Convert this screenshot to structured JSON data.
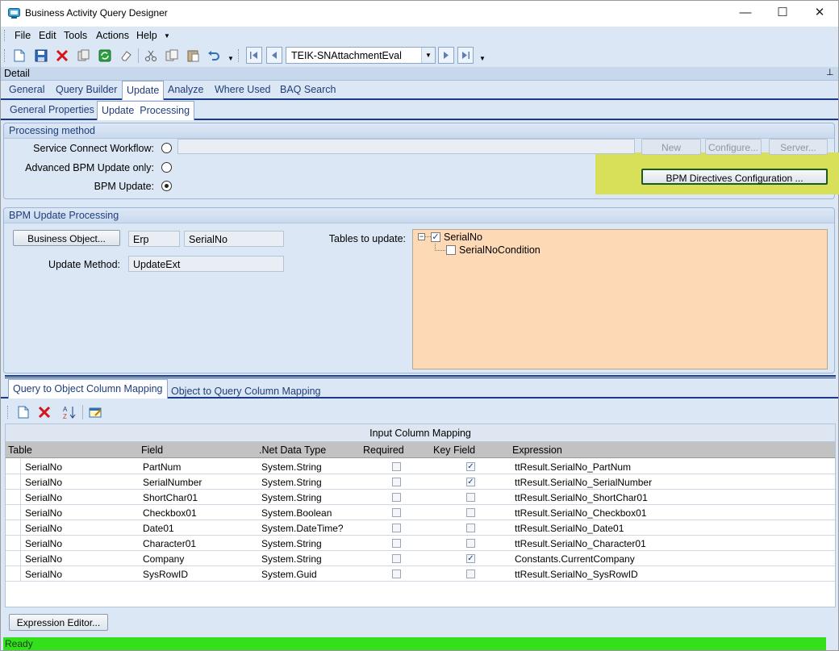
{
  "window": {
    "title": "Business Activity Query Designer",
    "minimize": "—",
    "maximize": "☐",
    "close": "✕"
  },
  "menu": [
    "File",
    "Edit",
    "Tools",
    "Actions",
    "Help"
  ],
  "toolbar": {
    "query_name": "TEIK-SNAttachmentEval"
  },
  "detail_label": "Detail",
  "main_tabs": [
    "General",
    "Query Builder",
    "Update",
    "Analyze",
    "Where Used",
    "BAQ Search"
  ],
  "sub_tabs": [
    "General Properties",
    "Update  Processing"
  ],
  "processing_method": {
    "header": "Processing method",
    "service_connect_label": "Service Connect Workflow:",
    "advanced_bpm_label": "Advanced BPM Update only:",
    "bpm_update_label": "BPM Update:",
    "new_button": "New",
    "configure_button": "Configure...",
    "server_button": "Server...",
    "bpm_directives_button": "BPM Directives Configuration ..."
  },
  "bpm_update_processing": {
    "header": "BPM Update Processing",
    "business_object_button": "Business Object...",
    "business_object_module": "Erp",
    "business_object_name": "SerialNo",
    "update_method_label": "Update Method:",
    "update_method_value": "UpdateExt",
    "tables_label": "Tables to update:",
    "tables": [
      {
        "name": "SerialNo",
        "checked": true
      },
      {
        "name": "SerialNoCondition",
        "checked": false
      }
    ]
  },
  "mapping_tabs": [
    "Query to Object Column Mapping",
    "Object to Query Column Mapping"
  ],
  "grid": {
    "title": "Input Column Mapping",
    "columns": [
      "Table",
      "Field",
      ".Net Data Type",
      "Required",
      "Key Field",
      "Expression"
    ],
    "rows": [
      {
        "table": "SerialNo",
        "field": "PartNum",
        "type": "System.String",
        "required": false,
        "key": true,
        "expression": "ttResult.SerialNo_PartNum"
      },
      {
        "table": "SerialNo",
        "field": "SerialNumber",
        "type": "System.String",
        "required": false,
        "key": true,
        "expression": "ttResult.SerialNo_SerialNumber"
      },
      {
        "table": "SerialNo",
        "field": "ShortChar01",
        "type": "System.String",
        "required": false,
        "key": false,
        "expression": "ttResult.SerialNo_ShortChar01"
      },
      {
        "table": "SerialNo",
        "field": "Checkbox01",
        "type": "System.Boolean",
        "required": false,
        "key": false,
        "expression": "ttResult.SerialNo_Checkbox01"
      },
      {
        "table": "SerialNo",
        "field": "Date01",
        "type": "System.DateTime?",
        "required": false,
        "key": false,
        "expression": "ttResult.SerialNo_Date01"
      },
      {
        "table": "SerialNo",
        "field": "Character01",
        "type": "System.String",
        "required": false,
        "key": false,
        "expression": "ttResult.SerialNo_Character01"
      },
      {
        "table": "SerialNo",
        "field": "Company",
        "type": "System.String",
        "required": false,
        "key": true,
        "expression": "Constants.CurrentCompany"
      },
      {
        "table": "SerialNo",
        "field": "SysRowID",
        "type": "System.Guid",
        "required": false,
        "key": false,
        "expression": "ttResult.SerialNo_SysRowID"
      }
    ]
  },
  "expression_editor_button": "Expression Editor...",
  "status": "Ready",
  "colors": {
    "accent": "#1a3b87",
    "highlight": "#d8e05a",
    "tree_bg": "#fdd9b5",
    "status_green": "#33e01b"
  }
}
